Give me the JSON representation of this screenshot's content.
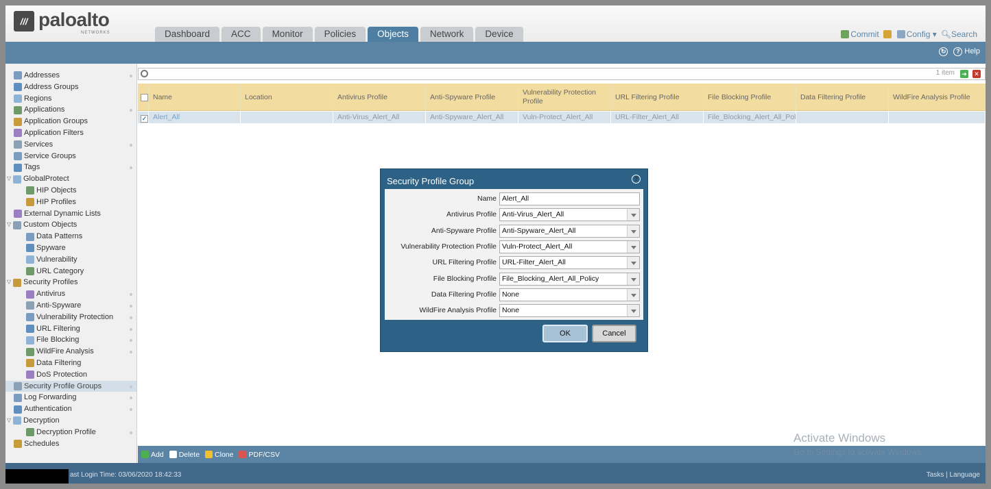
{
  "brand": {
    "name": "paloalto",
    "sub": "NETWORKS"
  },
  "tabs": [
    "Dashboard",
    "ACC",
    "Monitor",
    "Policies",
    "Objects",
    "Network",
    "Device"
  ],
  "active_tab": "Objects",
  "top_actions": {
    "commit": "Commit",
    "config": "Config ▾",
    "search": "Search"
  },
  "help_label": "Help",
  "sidebar": [
    {
      "label": "Addresses",
      "level": 0,
      "dot": true
    },
    {
      "label": "Address Groups",
      "level": 0
    },
    {
      "label": "Regions",
      "level": 0
    },
    {
      "label": "Applications",
      "level": 0,
      "dot": true
    },
    {
      "label": "Application Groups",
      "level": 0
    },
    {
      "label": "Application Filters",
      "level": 0
    },
    {
      "label": "Services",
      "level": 0,
      "dot": true
    },
    {
      "label": "Service Groups",
      "level": 0
    },
    {
      "label": "Tags",
      "level": 0,
      "dot": true
    },
    {
      "label": "GlobalProtect",
      "level": 0,
      "expanded": true
    },
    {
      "label": "HIP Objects",
      "level": 1
    },
    {
      "label": "HIP Profiles",
      "level": 1
    },
    {
      "label": "External Dynamic Lists",
      "level": 0
    },
    {
      "label": "Custom Objects",
      "level": 0,
      "expanded": true
    },
    {
      "label": "Data Patterns",
      "level": 1
    },
    {
      "label": "Spyware",
      "level": 1
    },
    {
      "label": "Vulnerability",
      "level": 1
    },
    {
      "label": "URL Category",
      "level": 1
    },
    {
      "label": "Security Profiles",
      "level": 0,
      "expanded": true
    },
    {
      "label": "Antivirus",
      "level": 1,
      "dot": true
    },
    {
      "label": "Anti-Spyware",
      "level": 1,
      "dot": true
    },
    {
      "label": "Vulnerability Protection",
      "level": 1,
      "dot": true
    },
    {
      "label": "URL Filtering",
      "level": 1,
      "dot": true
    },
    {
      "label": "File Blocking",
      "level": 1,
      "dot": true
    },
    {
      "label": "WildFire Analysis",
      "level": 1,
      "dot": true
    },
    {
      "label": "Data Filtering",
      "level": 1
    },
    {
      "label": "DoS Protection",
      "level": 1
    },
    {
      "label": "Security Profile Groups",
      "level": 0,
      "dot": true,
      "selected": true
    },
    {
      "label": "Log Forwarding",
      "level": 0,
      "dot": true
    },
    {
      "label": "Authentication",
      "level": 0,
      "dot": true
    },
    {
      "label": "Decryption",
      "level": 0,
      "expanded": true
    },
    {
      "label": "Decryption Profile",
      "level": 1,
      "dot": true
    },
    {
      "label": "Schedules",
      "level": 0
    }
  ],
  "search": {
    "count": "1 item"
  },
  "table": {
    "columns": [
      "Name",
      "Location",
      "Antivirus Profile",
      "Anti-Spyware Profile",
      "Vulnerability Protection Profile",
      "URL Filtering Profile",
      "File Blocking Profile",
      "Data Filtering Profile",
      "WildFire Analysis Profile"
    ],
    "rows": [
      [
        "Alert_All",
        "",
        "Anti-Virus_Alert_All",
        "Anti-Spyware_Alert_All",
        "Vuln-Protect_Alert_All",
        "URL-Filter_Alert_All",
        "File_Blocking_Alert_All_Pol...",
        "",
        ""
      ]
    ]
  },
  "bottom_actions": [
    "Add",
    "Delete",
    "Clone",
    "PDF/CSV"
  ],
  "watermark": {
    "line1": "Activate Windows",
    "line2": "Go to Settings to activate Windows."
  },
  "status": {
    "last_login": "ast Login Time: 03/06/2020 18:42:33",
    "right": "Tasks | Language"
  },
  "dialog": {
    "title": "Security Profile Group",
    "fields": [
      {
        "label": "Name",
        "value": "Alert_All",
        "type": "text"
      },
      {
        "label": "Antivirus Profile",
        "value": "Anti-Virus_Alert_All",
        "type": "select"
      },
      {
        "label": "Anti-Spyware Profile",
        "value": "Anti-Spyware_Alert_All",
        "type": "select"
      },
      {
        "label": "Vulnerability Protection Profile",
        "value": "Vuln-Protect_Alert_All",
        "type": "select"
      },
      {
        "label": "URL Filtering Profile",
        "value": "URL-Filter_Alert_All",
        "type": "select"
      },
      {
        "label": "File Blocking Profile",
        "value": "File_Blocking_Alert_All_Policy",
        "type": "select"
      },
      {
        "label": "Data Filtering Profile",
        "value": "None",
        "type": "select"
      },
      {
        "label": "WildFire Analysis Profile",
        "value": "None",
        "type": "select"
      }
    ],
    "ok": "OK",
    "cancel": "Cancel"
  }
}
